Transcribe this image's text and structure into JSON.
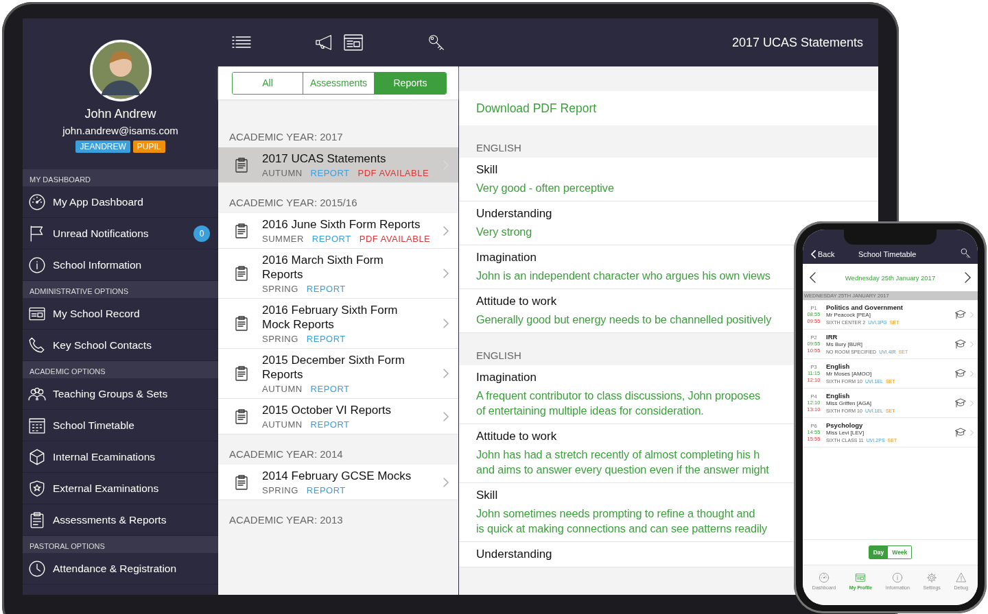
{
  "sidebar": {
    "profile": {
      "name": "John Andrew",
      "email": "john.andrew@isams.com",
      "badges": [
        {
          "text": "JEANDREW",
          "color": "#3a9fdb"
        },
        {
          "text": "PUPIL",
          "color": "#f0900a"
        }
      ]
    },
    "sections": [
      {
        "title": "MY DASHBOARD",
        "items": [
          {
            "label": "My App Dashboard"
          },
          {
            "label": "Unread Notifications",
            "count": "0"
          },
          {
            "label": "School Information"
          }
        ]
      },
      {
        "title": "ADMINISTRATIVE OPTIONS",
        "items": [
          {
            "label": "My School Record"
          },
          {
            "label": "Key School Contacts"
          }
        ]
      },
      {
        "title": "ACADEMIC OPTIONS",
        "items": [
          {
            "label": "Teaching Groups & Sets"
          },
          {
            "label": "School Timetable"
          },
          {
            "label": "Internal Ecaminations"
          },
          {
            "label": "External Examinations"
          },
          {
            "label": "Assessments & Reports"
          }
        ]
      },
      {
        "title": "PASTORAL OPTIONS",
        "items": [
          {
            "label": "Attendance & Registration"
          }
        ]
      }
    ]
  },
  "list": {
    "tabs": [
      {
        "label": "All",
        "selected": false
      },
      {
        "label": "Assessments",
        "selected": false
      },
      {
        "label": "Reports",
        "selected": true
      }
    ],
    "groups": [
      {
        "heading": "ACADEMIC YEAR: 2017",
        "items": [
          {
            "title": [
              "2017 UCAS Statements"
            ],
            "term": "AUTUMN",
            "type": "REPORT",
            "status": "PDF AVAILABLE",
            "selected": true
          }
        ]
      },
      {
        "heading": "ACADEMIC YEAR: 2015/16",
        "items": [
          {
            "title": [
              "2016 June Sixth Form Reports"
            ],
            "term": "SUMMER",
            "type": "REPORT",
            "status": "PDF AVAILABLE",
            "selected": false
          },
          {
            "title": [
              "2016 March Sixth Form",
              "Reports"
            ],
            "term": "SPRING",
            "type": "REPORT",
            "selected": false
          },
          {
            "title": [
              "2016 February Sixth Form",
              "Mock Reports"
            ],
            "term": "SPRING",
            "type": "REPORT",
            "selected": false
          },
          {
            "title": [
              "2015 December Sixth Form",
              "Reports"
            ],
            "term": "AUTUMN",
            "type": "REPORT",
            "selected": false
          },
          {
            "title": [
              "2015 October VI Reports"
            ],
            "term": "AUTUMN",
            "type": "REPORT",
            "selected": false
          }
        ]
      },
      {
        "heading": "ACADEMIC YEAR: 2014",
        "items": [
          {
            "title": [
              "2014 February GCSE Mocks"
            ],
            "term": "SPRING",
            "type": "REPORT",
            "selected": false
          }
        ]
      },
      {
        "heading": "ACADEMIC YEAR: 2013"
      }
    ]
  },
  "detail": {
    "title": "2017 UCAS Statements",
    "download": "Download PDF Report",
    "sections": [
      {
        "heading": "ENGLISH",
        "entries": [
          {
            "label": "Skill",
            "value": [
              "Very good - often perceptive"
            ]
          },
          {
            "label": "Understanding",
            "value": [
              "Very strong"
            ]
          },
          {
            "label": "Imagination",
            "value": [
              "John is an independent character who argues his own views"
            ]
          },
          {
            "label": "Attitude to work",
            "value": [
              "Generally good but energy needs to be channelled positively"
            ]
          }
        ]
      },
      {
        "heading": "ENGLISH",
        "entries": [
          {
            "label": "Imagination",
            "value": [
              "A frequent contributor to class discussions, John proposes",
              "of entertaining multiple ideas for consideration."
            ]
          },
          {
            "label": "Attitude to work",
            "value": [
              "John has had a stretch recently of almost completing his h",
              "and aims to answer every question even if the answer might"
            ]
          },
          {
            "label": "Skill",
            "value": [
              "John sometimes needs prompting to refine a thought and",
              "is quick at making connections and can see patterns readily"
            ]
          },
          {
            "label": "Understanding"
          }
        ]
      }
    ]
  },
  "phone": {
    "back": "Back",
    "title": "School Timetable",
    "date": "Wednesday 25th January 2017",
    "day_heading": "WEDNESDAY 25TH JANUARY 2017",
    "lessons": [
      {
        "period": "P1",
        "start": "08:55",
        "end": "09:55",
        "subject": "Politics and Government",
        "teacher": "Mr Peacock [PEA]",
        "room": "SIXTH CENTER 2",
        "set": "UVI.3PG",
        "set_label": "SET"
      },
      {
        "period": "P2",
        "start": "09:55",
        "end": "10:55",
        "subject": "IRR",
        "teacher": "Ms Bury [BUR]",
        "room": "NO ROOM SPECIFIED",
        "set": "UVI.4IR",
        "set_label": "SET"
      },
      {
        "period": "P3",
        "start": "11:15",
        "end": "12:10",
        "subject": "English",
        "teacher": "Mr Moses [AMOO]",
        "room": "SIXTH FORM 10",
        "set": "UVI.1EL",
        "set_label": "SET"
      },
      {
        "period": "P4",
        "start": "12:10",
        "end": "13:10",
        "subject": "English",
        "teacher": "Miss Griffen [AGA]",
        "room": "SIXTH FORM 10",
        "set": "UVI.1EL",
        "set_label": "SET"
      },
      {
        "period": "P6",
        "start": "14:55",
        "end": "15:55",
        "subject": "Psychology",
        "teacher": "Miss Levi [LEV]",
        "room": "SIXTH CLASS 11",
        "set": "UVI.2PS",
        "set_label": "SET"
      }
    ],
    "view": [
      {
        "label": "Day",
        "selected": true
      },
      {
        "label": "Week",
        "selected": false
      }
    ],
    "tabbar": [
      {
        "label": "Dashboard",
        "selected": false
      },
      {
        "label": "My Profile",
        "selected": true
      },
      {
        "label": "Information",
        "selected": false
      },
      {
        "label": "Settings",
        "selected": false
      },
      {
        "label": "Debug",
        "selected": false
      }
    ]
  }
}
